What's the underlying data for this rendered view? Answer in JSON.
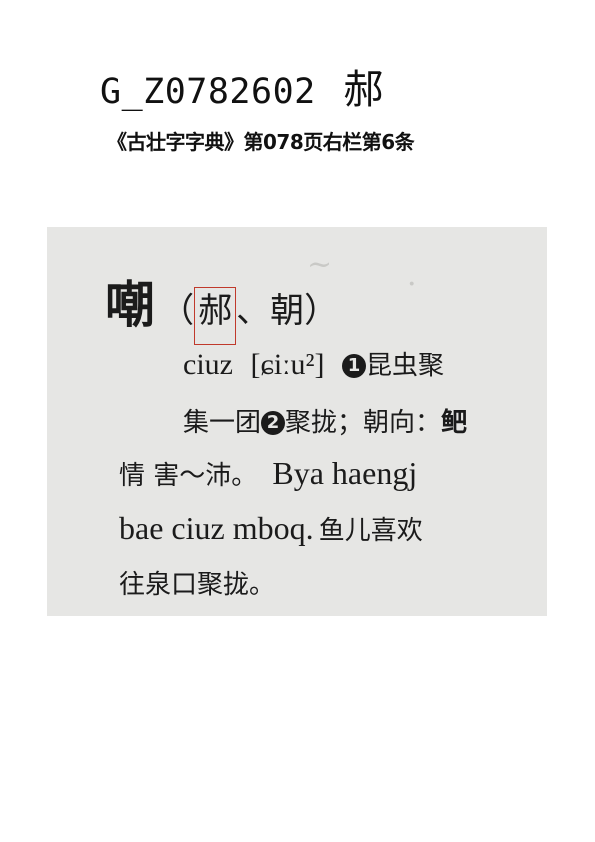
{
  "heading": {
    "code": "G_Z0782602",
    "character": "郝"
  },
  "source": "《古壮字字典》第078页右栏第6条",
  "entry": {
    "head_character": "嘲",
    "variant_open": "（",
    "variant_boxed": "郝",
    "variant_rest": "、朝",
    "variant_close": "）",
    "romanization": "ciuz",
    "ipa": "[ɕiːu²]",
    "sense1_marker": "1",
    "sense1_text": "昆虫聚",
    "line2_text1": "集一团",
    "sense2_marker": "2",
    "line2_text2": "聚拢；朝向：",
    "line2_text3": "鲃",
    "line3_cjk": "情 害～沛。",
    "line3_latin": "Bya haengj",
    "line4_latin": "bae ciuz mboq.",
    "line4_cjk": "鱼儿喜欢",
    "line5_cjk": "往泉口聚拢。"
  }
}
